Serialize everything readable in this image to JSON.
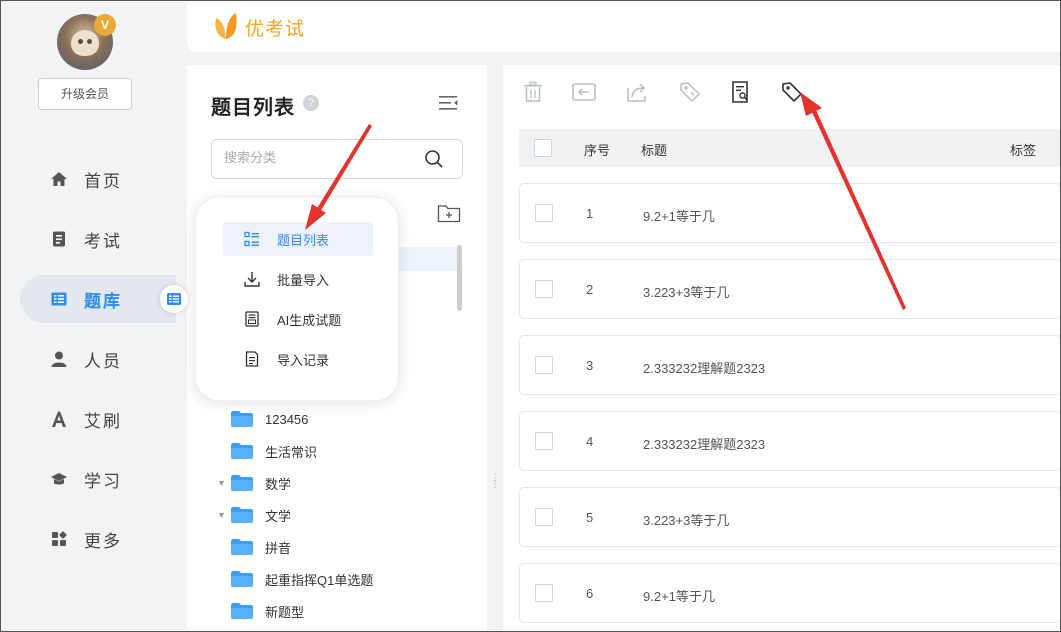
{
  "user": {
    "vip_badge": "V",
    "upgrade_label": "升级会员"
  },
  "nav": {
    "items": [
      {
        "label": "首页",
        "icon": "home-icon"
      },
      {
        "label": "考试",
        "icon": "exam-icon"
      },
      {
        "label": "题库",
        "icon": "question-bank-icon",
        "active": true
      },
      {
        "label": "人员",
        "icon": "person-icon"
      },
      {
        "label": "艾刷",
        "icon": "brush-icon"
      },
      {
        "label": "学习",
        "icon": "graduation-cap-icon"
      },
      {
        "label": "更多",
        "icon": "apps-icon"
      }
    ]
  },
  "header": {
    "app_name": "优考试"
  },
  "category_panel": {
    "title": "题目列表",
    "help": "?",
    "search_placeholder": "搜索分类",
    "tree": [
      {
        "label": "123456",
        "arrow": ""
      },
      {
        "label": "生活常识",
        "arrow": ""
      },
      {
        "label": "数学",
        "arrow": "▼"
      },
      {
        "label": "文学",
        "arrow": "▼"
      },
      {
        "label": "拼音",
        "arrow": ""
      },
      {
        "label": "起重指挥Q1单选题",
        "arrow": ""
      },
      {
        "label": "新题型",
        "arrow": ""
      }
    ]
  },
  "popup_menu": {
    "items": [
      {
        "label": "题目列表",
        "icon": "list-icon",
        "active": true
      },
      {
        "label": "批量导入",
        "icon": "download-icon"
      },
      {
        "label": "AI生成试题",
        "icon": "ai-document-icon"
      },
      {
        "label": "导入记录",
        "icon": "record-icon"
      }
    ]
  },
  "question_table": {
    "columns": {
      "index": "序号",
      "title": "标题",
      "tags": "标签"
    },
    "rows": [
      {
        "index": "1",
        "title": "9.2+1等于几"
      },
      {
        "index": "2",
        "title": "3.223+3等于几"
      },
      {
        "index": "3",
        "title": "2.333232理解题2323"
      },
      {
        "index": "4",
        "title": "2.333232理解题2323"
      },
      {
        "index": "5",
        "title": "3.223+3等于几"
      },
      {
        "index": "6",
        "title": "9.2+1等于几"
      }
    ]
  },
  "colors": {
    "accent": "#2d8cf0",
    "brand": "#f5a623",
    "annotation_arrow": "#e5322d",
    "folder": "#3a9ff5"
  }
}
